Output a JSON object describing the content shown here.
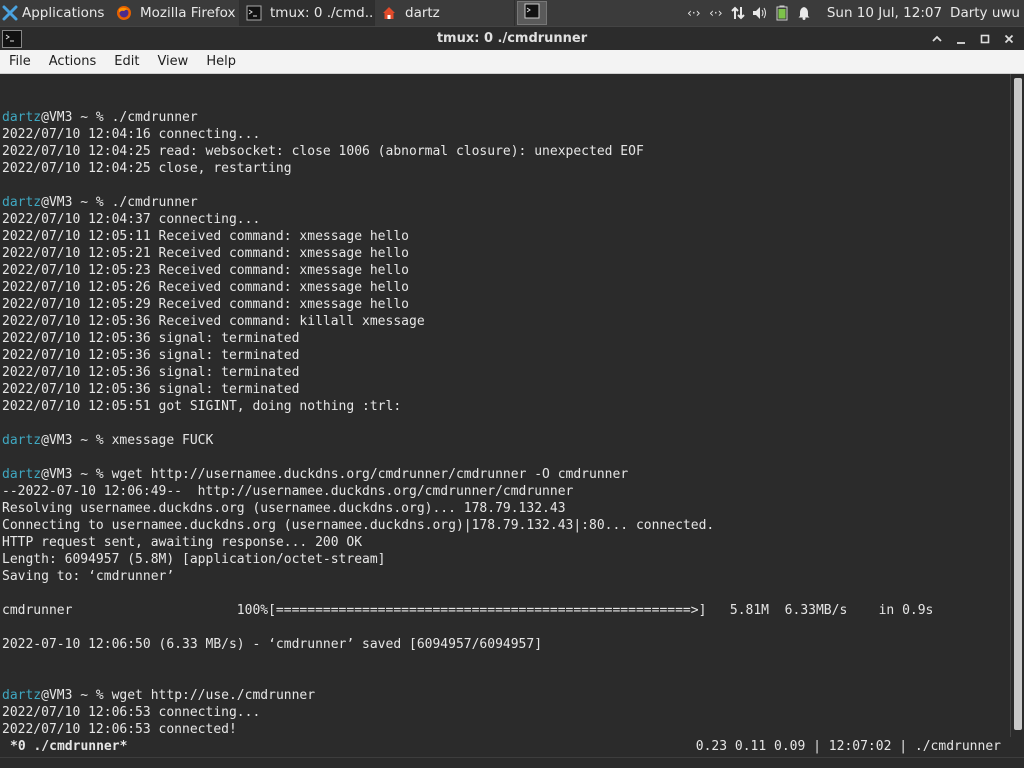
{
  "panel": {
    "applications_label": "Applications",
    "tasks": [
      {
        "label": "Mozilla Firefox",
        "icon": "firefox-icon"
      },
      {
        "label": "tmux: 0 ./cmd...",
        "icon": "terminal-icon"
      },
      {
        "label": "dartz",
        "icon": "home-folder-icon"
      }
    ],
    "clock": "Sun 10 Jul, 12:07",
    "user": "Darty uwu"
  },
  "window": {
    "title": "tmux: 0 ./cmdrunner"
  },
  "menubar": {
    "items": [
      "File",
      "Actions",
      "Edit",
      "View",
      "Help"
    ]
  },
  "terminal": {
    "lines": [
      {
        "user": "",
        "text": ""
      },
      {
        "user": "dartz",
        "text": "@VM3 ~ % ./cmdrunner"
      },
      {
        "user": "",
        "text": "2022/07/10 12:04:16 connecting..."
      },
      {
        "user": "",
        "text": "2022/07/10 12:04:25 read: websocket: close 1006 (abnormal closure): unexpected EOF"
      },
      {
        "user": "",
        "text": "2022/07/10 12:04:25 close, restarting"
      },
      {
        "user": "",
        "text": ""
      },
      {
        "user": "dartz",
        "text": "@VM3 ~ % ./cmdrunner"
      },
      {
        "user": "",
        "text": "2022/07/10 12:04:37 connecting..."
      },
      {
        "user": "",
        "text": "2022/07/10 12:05:11 Received command: xmessage hello"
      },
      {
        "user": "",
        "text": "2022/07/10 12:05:21 Received command: xmessage hello"
      },
      {
        "user": "",
        "text": "2022/07/10 12:05:23 Received command: xmessage hello"
      },
      {
        "user": "",
        "text": "2022/07/10 12:05:26 Received command: xmessage hello"
      },
      {
        "user": "",
        "text": "2022/07/10 12:05:29 Received command: xmessage hello"
      },
      {
        "user": "",
        "text": "2022/07/10 12:05:36 Received command: killall xmessage"
      },
      {
        "user": "",
        "text": "2022/07/10 12:05:36 signal: terminated"
      },
      {
        "user": "",
        "text": "2022/07/10 12:05:36 signal: terminated"
      },
      {
        "user": "",
        "text": "2022/07/10 12:05:36 signal: terminated"
      },
      {
        "user": "",
        "text": "2022/07/10 12:05:36 signal: terminated"
      },
      {
        "user": "",
        "text": "2022/07/10 12:05:51 got SIGINT, doing nothing :trl:"
      },
      {
        "user": "",
        "text": ""
      },
      {
        "user": "dartz",
        "text": "@VM3 ~ % xmessage FUCK"
      },
      {
        "user": "",
        "text": ""
      },
      {
        "user": "dartz",
        "text": "@VM3 ~ % wget http://usernamee.duckdns.org/cmdrunner/cmdrunner -O cmdrunner"
      },
      {
        "user": "",
        "text": "--2022-07-10 12:06:49--  http://usernamee.duckdns.org/cmdrunner/cmdrunner"
      },
      {
        "user": "",
        "text": "Resolving usernamee.duckdns.org (usernamee.duckdns.org)... 178.79.132.43"
      },
      {
        "user": "",
        "text": "Connecting to usernamee.duckdns.org (usernamee.duckdns.org)|178.79.132.43|:80... connected."
      },
      {
        "user": "",
        "text": "HTTP request sent, awaiting response... 200 OK"
      },
      {
        "user": "",
        "text": "Length: 6094957 (5.8M) [application/octet-stream]"
      },
      {
        "user": "",
        "text": "Saving to: ‘cmdrunner’"
      },
      {
        "user": "",
        "text": ""
      },
      {
        "user": "",
        "text": "cmdrunner                     100%[=====================================================>]   5.81M  6.33MB/s    in 0.9s"
      },
      {
        "user": "",
        "text": ""
      },
      {
        "user": "",
        "text": "2022-07-10 12:06:50 (6.33 MB/s) - ‘cmdrunner’ saved [6094957/6094957]"
      },
      {
        "user": "",
        "text": ""
      },
      {
        "user": "",
        "text": ""
      },
      {
        "user": "dartz",
        "text": "@VM3 ~ % wget http://use./cmdrunner"
      },
      {
        "user": "",
        "text": "2022/07/10 12:06:53 connecting..."
      },
      {
        "user": "",
        "text": "2022/07/10 12:06:53 connected!"
      }
    ]
  },
  "status": {
    "left": "*0 ./cmdrunner*",
    "right": "0.23 0.11 0.09 | 12:07:02 | ./cmdrunner"
  }
}
